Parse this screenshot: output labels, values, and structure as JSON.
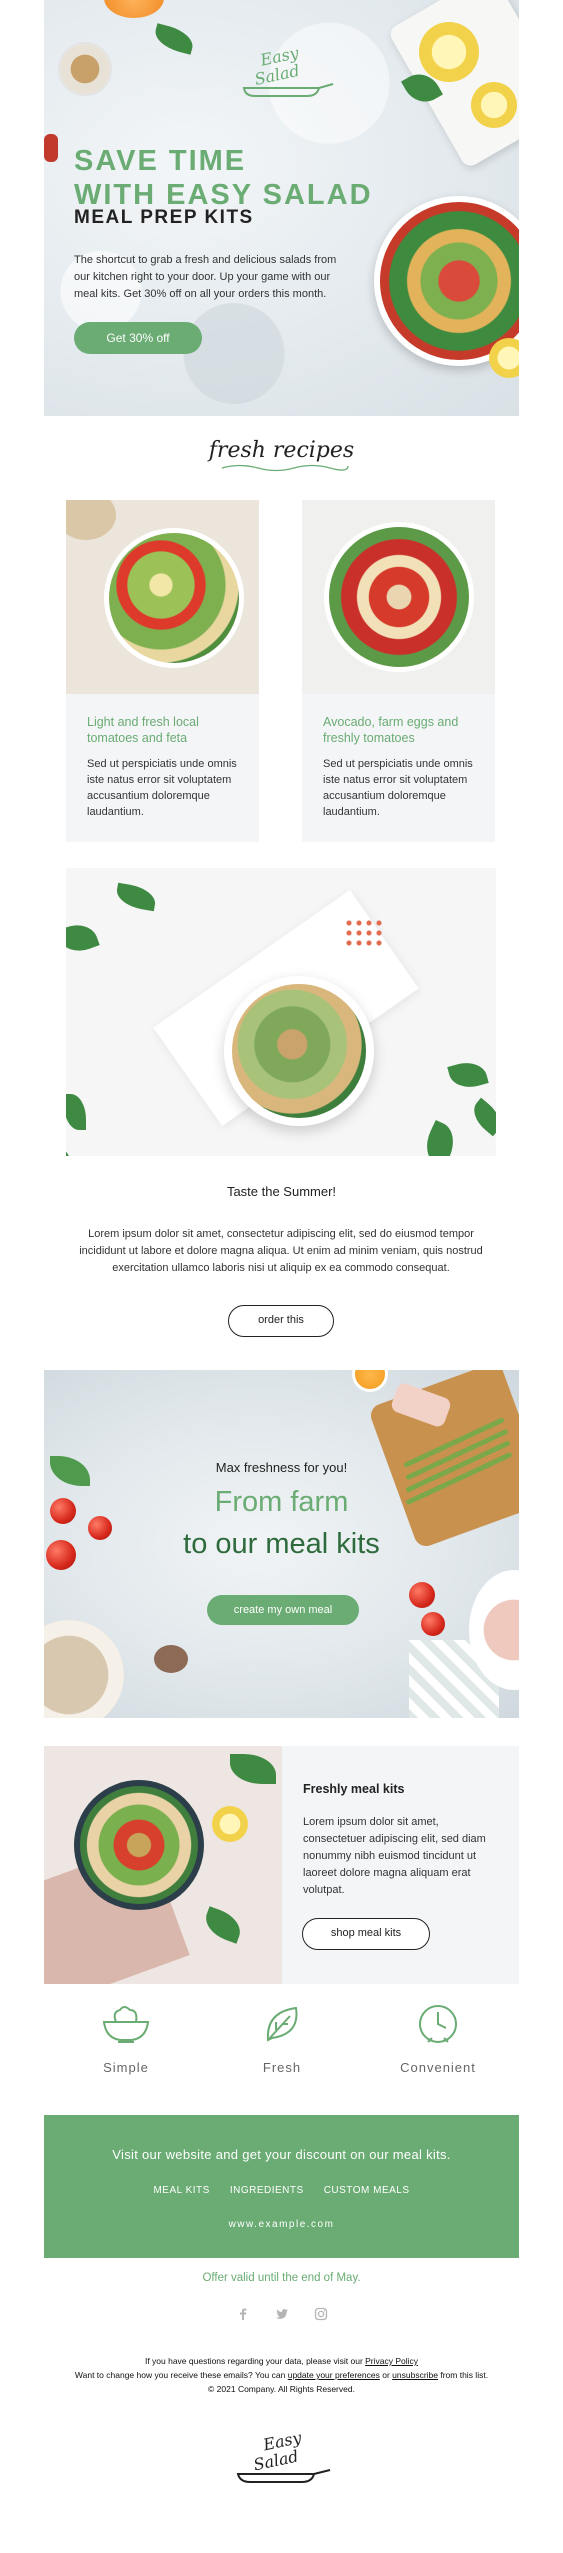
{
  "hero": {
    "logo_line1": "Easy",
    "logo_line2": "Salad",
    "title_line1": "SAVE TIME",
    "title_line2": "WITH EASY SALAD",
    "subtitle": "MEAL PREP KITS",
    "body": "The shortcut to grab a fresh and delicious salads from our kitchen right to your door. Up your game with our meal kits.  Get 30% off on all your orders this month.",
    "cta": "Get 30% off"
  },
  "recipes": {
    "heading": "fresh recipes",
    "cards": [
      {
        "title": "Light and fresh local tomatoes and feta",
        "text": "Sed ut perspiciatis unde omnis iste natus error sit voluptatem accusantium doloremque laudantium."
      },
      {
        "title": "Avocado, farm eggs and freshly tomatoes",
        "text": "Sed ut perspiciatis unde omnis iste natus error sit voluptatem accusantium doloremque laudantium."
      }
    ]
  },
  "summer": {
    "title": "Taste the Summer!",
    "text": "Lorem ipsum dolor sit amet, consectetur adipiscing elit, sed do eiusmod tempor incididunt ut labore et dolore magna aliqua. Ut enim ad minim veniam, quis nostrud exercitation ullamco laboris nisi ut aliquip ex ea commodo consequat.",
    "cta": "order this"
  },
  "farm": {
    "small": "Max freshness for you!",
    "big1": "From farm",
    "big2": "to our meal kits",
    "cta": "create my own meal"
  },
  "meal_kits": {
    "title": "Freshly meal kits",
    "text": "Lorem ipsum dolor sit amet, consectetuer adipiscing elit, sed diam nonummy nibh euismod tincidunt ut laoreet dolore magna aliquam erat volutpat.",
    "cta": "shop meal kits"
  },
  "features": [
    {
      "icon": "salad-bowl-icon",
      "label": "Simple"
    },
    {
      "icon": "leaf-icon",
      "label": "Fresh"
    },
    {
      "icon": "clock-icon",
      "label": "Convenient"
    }
  ],
  "footer": {
    "promo": "Visit our website and get your discount on our meal kits.",
    "nav": [
      "MEAL KITS",
      "INGREDIENTS",
      "CUSTOM MEALS"
    ],
    "url": "www.example.com",
    "offer": "Offer valid until the end of May.",
    "social": [
      "facebook-icon",
      "twitter-icon",
      "instagram-icon"
    ],
    "legal1_pre": "If you have questions regarding your data, please visit our ",
    "legal1_link": "Privacy Policy",
    "legal2_pre": "Want to change how you receive these emails? You can ",
    "legal2_link1": "update your preferences",
    "legal2_mid": " or ",
    "legal2_link2": "unsubscribe",
    "legal2_post": " from this list.",
    "legal3": "© 2021 Company. All Rights Reserved.",
    "logo_line1": "Easy",
    "logo_line2": "Salad"
  },
  "colors": {
    "accent": "#6aac73",
    "dark_green": "#2e6b3c",
    "card_bg": "#f4f5f7"
  }
}
